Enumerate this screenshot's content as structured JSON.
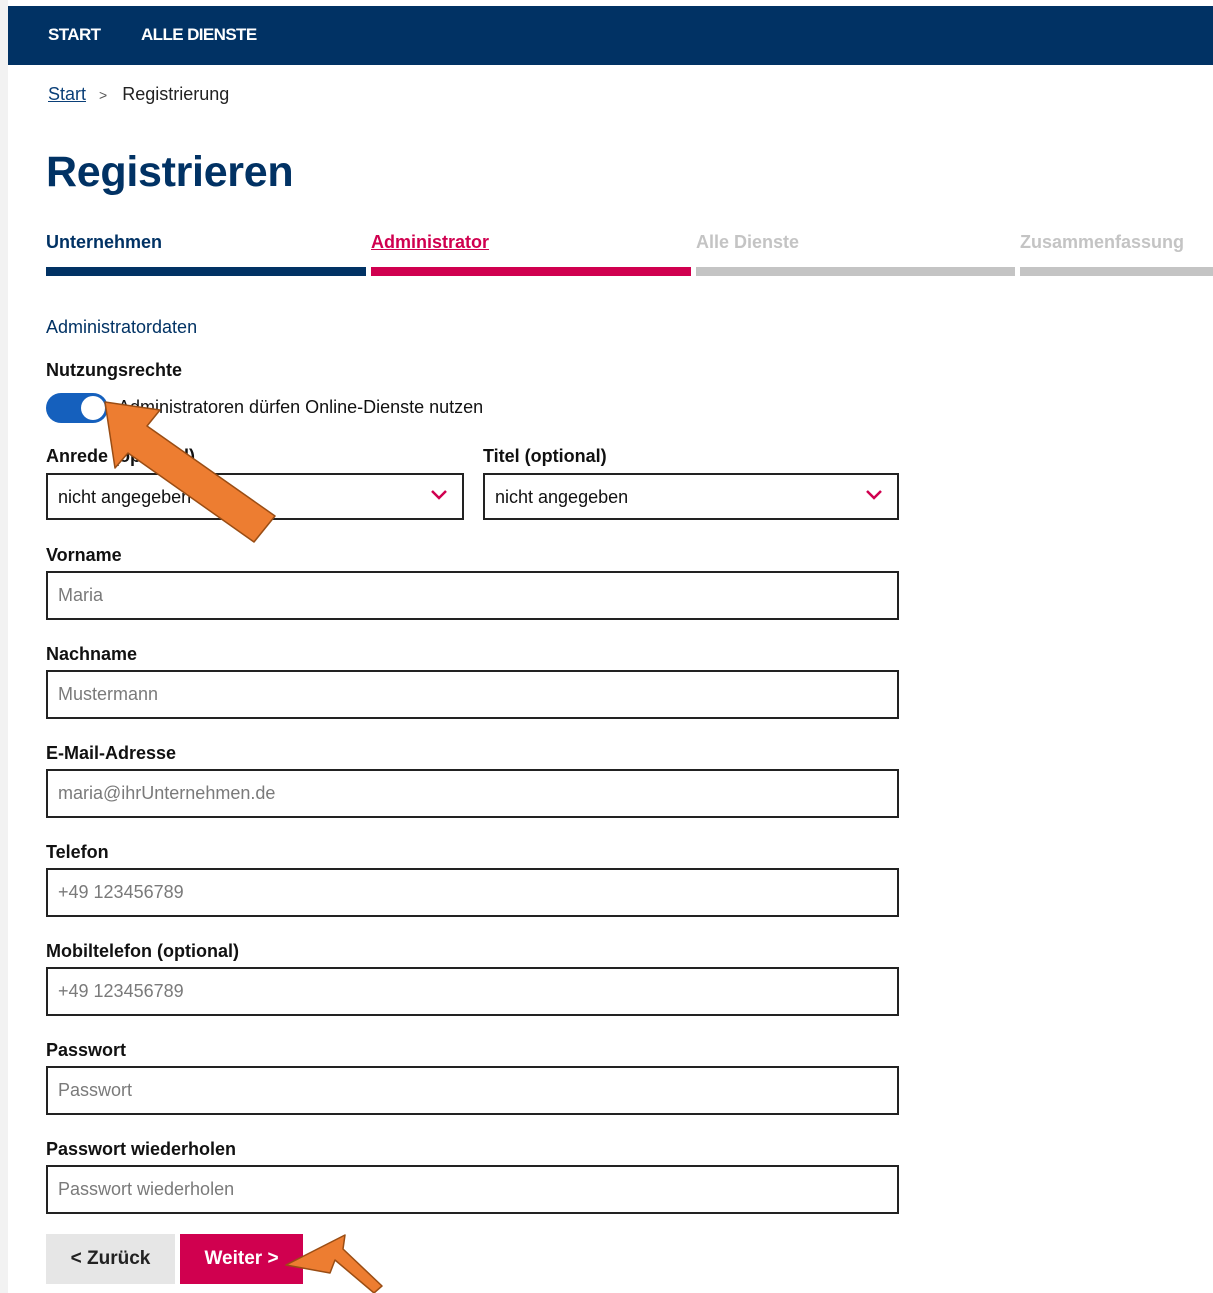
{
  "nav": {
    "items": [
      "START",
      "ALLE DIENSTE"
    ]
  },
  "breadcrumb": {
    "home": "Start",
    "separator": ">",
    "current": "Registrierung"
  },
  "page": {
    "title": "Registrieren"
  },
  "steps": [
    {
      "label": "Unternehmen",
      "state": "done"
    },
    {
      "label": "Administrator",
      "state": "active"
    },
    {
      "label": "Alle Dienste",
      "state": "pending"
    },
    {
      "label": "Zusammenfassung",
      "state": "pending"
    }
  ],
  "form": {
    "section_title": "Administratordaten",
    "usage_rights": {
      "label": "Nutzungsrechte",
      "toggle_on": true,
      "toggle_label": "Administratoren dürfen Online-Dienste nutzen"
    },
    "salutation": {
      "label": "Anrede (optional)",
      "value": "nicht angegeben"
    },
    "title": {
      "label": "Titel (optional)",
      "value": "nicht angegeben"
    },
    "first_name": {
      "label": "Vorname",
      "placeholder": "Maria"
    },
    "last_name": {
      "label": "Nachname",
      "placeholder": "Mustermann"
    },
    "email": {
      "label": "E-Mail-Adresse",
      "placeholder": "maria@ihrUnternehmen.de"
    },
    "phone": {
      "label": "Telefon",
      "placeholder": "+49 123456789"
    },
    "mobile": {
      "label": "Mobiltelefon (optional)",
      "placeholder": "+49 123456789"
    },
    "password": {
      "label": "Passwort",
      "placeholder": "Passwort"
    },
    "password_repeat": {
      "label": "Passwort wiederholen",
      "placeholder": "Passwort wiederholen"
    }
  },
  "buttons": {
    "back": "< Zurück",
    "next": "Weiter >"
  },
  "colors": {
    "navy": "#013264",
    "accent": "#d0004f",
    "toggle": "#1560bd",
    "inactive": "#c4c4c4",
    "annotation_arrow": "#ed7d31"
  }
}
